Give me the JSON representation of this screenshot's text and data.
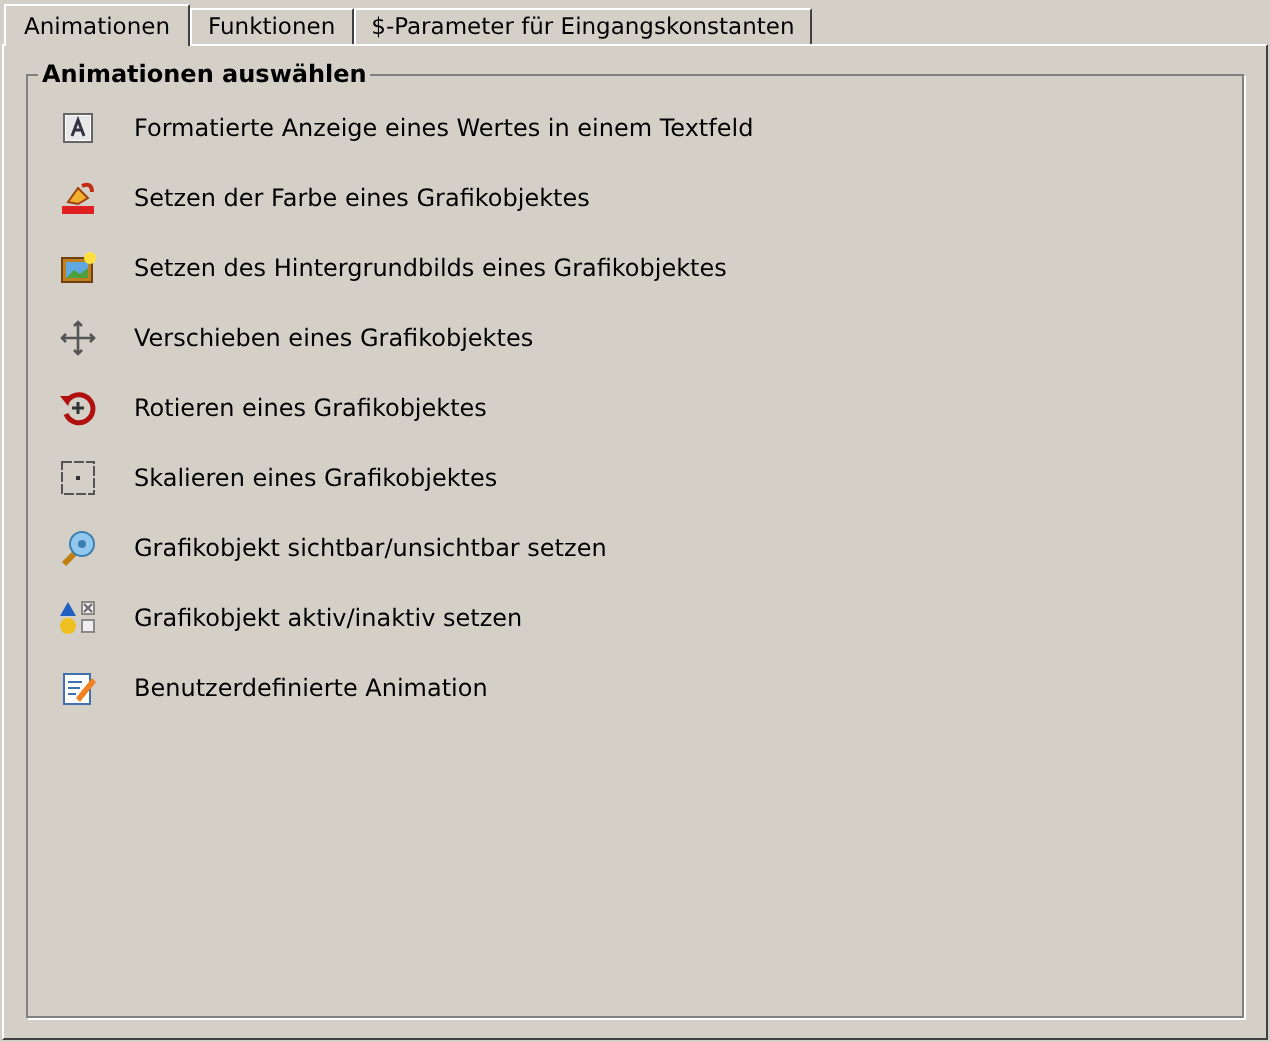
{
  "tabs": [
    {
      "label": "Animationen",
      "selected": true
    },
    {
      "label": "Funktionen",
      "selected": false
    },
    {
      "label": "$-Parameter für Eingangskonstanten",
      "selected": false
    }
  ],
  "group": {
    "title": "Animationen auswählen",
    "items": [
      {
        "kind": "text",
        "label": "Formatierte Anzeige eines Wertes in einem Textfeld"
      },
      {
        "kind": "color",
        "label": "Setzen der Farbe eines Grafikobjektes"
      },
      {
        "kind": "background",
        "label": "Setzen des Hintergrundbilds eines Grafikobjektes"
      },
      {
        "kind": "move",
        "label": "Verschieben eines Grafikobjektes"
      },
      {
        "kind": "rotate",
        "label": "Rotieren eines Grafikobjektes"
      },
      {
        "kind": "scale",
        "label": "Skalieren eines Grafikobjektes"
      },
      {
        "kind": "visibility",
        "label": "Grafikobjekt sichtbar/unsichtbar setzen"
      },
      {
        "kind": "active",
        "label": "Grafikobjekt aktiv/inaktiv setzen"
      },
      {
        "kind": "custom",
        "label": "Benutzerdefinierte Animation"
      }
    ]
  }
}
